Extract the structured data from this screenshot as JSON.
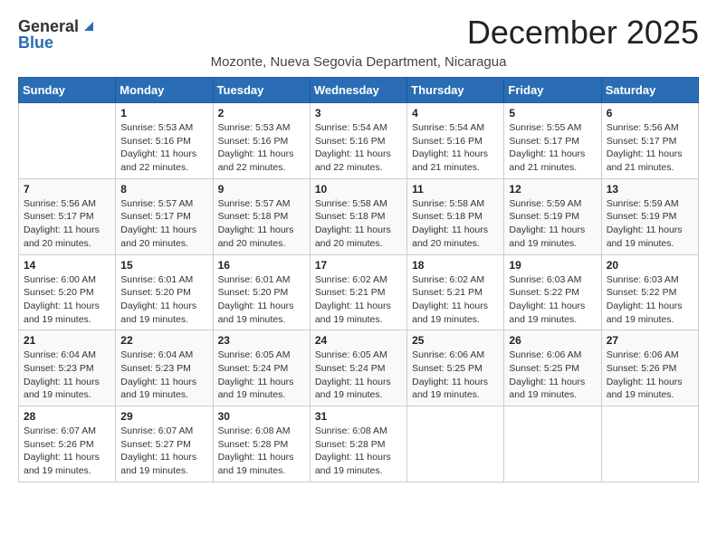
{
  "header": {
    "logo_general": "General",
    "logo_blue": "Blue",
    "month": "December 2025",
    "location": "Mozonte, Nueva Segovia Department, Nicaragua"
  },
  "calendar": {
    "days_of_week": [
      "Sunday",
      "Monday",
      "Tuesday",
      "Wednesday",
      "Thursday",
      "Friday",
      "Saturday"
    ],
    "weeks": [
      [
        {
          "day": "",
          "info": ""
        },
        {
          "day": "1",
          "info": "Sunrise: 5:53 AM\nSunset: 5:16 PM\nDaylight: 11 hours and 22 minutes."
        },
        {
          "day": "2",
          "info": "Sunrise: 5:53 AM\nSunset: 5:16 PM\nDaylight: 11 hours and 22 minutes."
        },
        {
          "day": "3",
          "info": "Sunrise: 5:54 AM\nSunset: 5:16 PM\nDaylight: 11 hours and 22 minutes."
        },
        {
          "day": "4",
          "info": "Sunrise: 5:54 AM\nSunset: 5:16 PM\nDaylight: 11 hours and 21 minutes."
        },
        {
          "day": "5",
          "info": "Sunrise: 5:55 AM\nSunset: 5:17 PM\nDaylight: 11 hours and 21 minutes."
        },
        {
          "day": "6",
          "info": "Sunrise: 5:56 AM\nSunset: 5:17 PM\nDaylight: 11 hours and 21 minutes."
        }
      ],
      [
        {
          "day": "7",
          "info": "Sunrise: 5:56 AM\nSunset: 5:17 PM\nDaylight: 11 hours and 20 minutes."
        },
        {
          "day": "8",
          "info": "Sunrise: 5:57 AM\nSunset: 5:17 PM\nDaylight: 11 hours and 20 minutes."
        },
        {
          "day": "9",
          "info": "Sunrise: 5:57 AM\nSunset: 5:18 PM\nDaylight: 11 hours and 20 minutes."
        },
        {
          "day": "10",
          "info": "Sunrise: 5:58 AM\nSunset: 5:18 PM\nDaylight: 11 hours and 20 minutes."
        },
        {
          "day": "11",
          "info": "Sunrise: 5:58 AM\nSunset: 5:18 PM\nDaylight: 11 hours and 20 minutes."
        },
        {
          "day": "12",
          "info": "Sunrise: 5:59 AM\nSunset: 5:19 PM\nDaylight: 11 hours and 19 minutes."
        },
        {
          "day": "13",
          "info": "Sunrise: 5:59 AM\nSunset: 5:19 PM\nDaylight: 11 hours and 19 minutes."
        }
      ],
      [
        {
          "day": "14",
          "info": "Sunrise: 6:00 AM\nSunset: 5:20 PM\nDaylight: 11 hours and 19 minutes."
        },
        {
          "day": "15",
          "info": "Sunrise: 6:01 AM\nSunset: 5:20 PM\nDaylight: 11 hours and 19 minutes."
        },
        {
          "day": "16",
          "info": "Sunrise: 6:01 AM\nSunset: 5:20 PM\nDaylight: 11 hours and 19 minutes."
        },
        {
          "day": "17",
          "info": "Sunrise: 6:02 AM\nSunset: 5:21 PM\nDaylight: 11 hours and 19 minutes."
        },
        {
          "day": "18",
          "info": "Sunrise: 6:02 AM\nSunset: 5:21 PM\nDaylight: 11 hours and 19 minutes."
        },
        {
          "day": "19",
          "info": "Sunrise: 6:03 AM\nSunset: 5:22 PM\nDaylight: 11 hours and 19 minutes."
        },
        {
          "day": "20",
          "info": "Sunrise: 6:03 AM\nSunset: 5:22 PM\nDaylight: 11 hours and 19 minutes."
        }
      ],
      [
        {
          "day": "21",
          "info": "Sunrise: 6:04 AM\nSunset: 5:23 PM\nDaylight: 11 hours and 19 minutes."
        },
        {
          "day": "22",
          "info": "Sunrise: 6:04 AM\nSunset: 5:23 PM\nDaylight: 11 hours and 19 minutes."
        },
        {
          "day": "23",
          "info": "Sunrise: 6:05 AM\nSunset: 5:24 PM\nDaylight: 11 hours and 19 minutes."
        },
        {
          "day": "24",
          "info": "Sunrise: 6:05 AM\nSunset: 5:24 PM\nDaylight: 11 hours and 19 minutes."
        },
        {
          "day": "25",
          "info": "Sunrise: 6:06 AM\nSunset: 5:25 PM\nDaylight: 11 hours and 19 minutes."
        },
        {
          "day": "26",
          "info": "Sunrise: 6:06 AM\nSunset: 5:25 PM\nDaylight: 11 hours and 19 minutes."
        },
        {
          "day": "27",
          "info": "Sunrise: 6:06 AM\nSunset: 5:26 PM\nDaylight: 11 hours and 19 minutes."
        }
      ],
      [
        {
          "day": "28",
          "info": "Sunrise: 6:07 AM\nSunset: 5:26 PM\nDaylight: 11 hours and 19 minutes."
        },
        {
          "day": "29",
          "info": "Sunrise: 6:07 AM\nSunset: 5:27 PM\nDaylight: 11 hours and 19 minutes."
        },
        {
          "day": "30",
          "info": "Sunrise: 6:08 AM\nSunset: 5:28 PM\nDaylight: 11 hours and 19 minutes."
        },
        {
          "day": "31",
          "info": "Sunrise: 6:08 AM\nSunset: 5:28 PM\nDaylight: 11 hours and 19 minutes."
        },
        {
          "day": "",
          "info": ""
        },
        {
          "day": "",
          "info": ""
        },
        {
          "day": "",
          "info": ""
        }
      ]
    ]
  }
}
